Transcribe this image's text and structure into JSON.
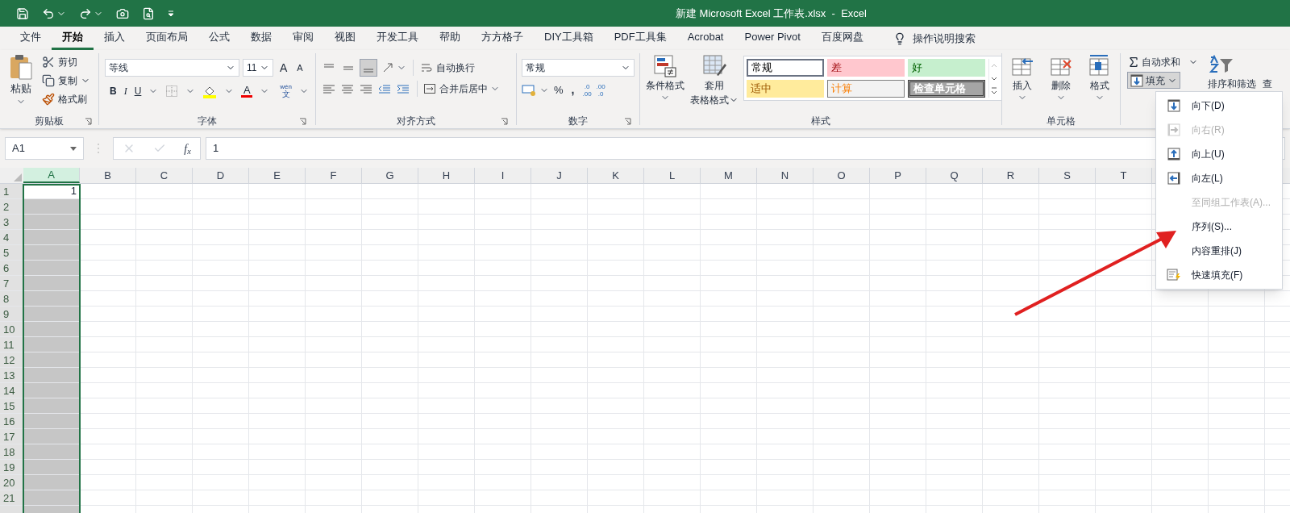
{
  "window": {
    "title": "新建 Microsoft Excel 工作表.xlsx  -  Excel"
  },
  "tabs": [
    {
      "label": "文件",
      "selected": false
    },
    {
      "label": "开始",
      "selected": true
    },
    {
      "label": "插入",
      "selected": false
    },
    {
      "label": "页面布局",
      "selected": false
    },
    {
      "label": "公式",
      "selected": false
    },
    {
      "label": "数据",
      "selected": false
    },
    {
      "label": "审阅",
      "selected": false
    },
    {
      "label": "视图",
      "selected": false
    },
    {
      "label": "开发工具",
      "selected": false
    },
    {
      "label": "帮助",
      "selected": false
    },
    {
      "label": "方方格子",
      "selected": false
    },
    {
      "label": "DIY工具箱",
      "selected": false
    },
    {
      "label": "PDF工具集",
      "selected": false
    },
    {
      "label": "Acrobat",
      "selected": false
    },
    {
      "label": "Power Pivot",
      "selected": false
    },
    {
      "label": "百度网盘",
      "selected": false
    }
  ],
  "tell_me": "操作说明搜索",
  "clipboard": {
    "paste": "粘贴",
    "cut": "剪切",
    "copy": "复制",
    "format_painter": "格式刷",
    "label": "剪贴板"
  },
  "font": {
    "name": "等线",
    "size": "11",
    "grow": "A",
    "shrink": "A",
    "bold": "B",
    "italic": "I",
    "underline": "U",
    "font_color": "A",
    "phonetic": [
      "wén",
      "文"
    ],
    "label": "字体"
  },
  "alignment": {
    "wrap": "自动换行",
    "merge": "合并后居中",
    "label": "对齐方式"
  },
  "number": {
    "format": "常规",
    "percent": "%",
    "comma": ",",
    "increase_decimal": [
      ".0",
      ".00"
    ],
    "decrease_decimal": [
      ".00",
      ".0"
    ],
    "label": "数字"
  },
  "styles": {
    "conditional": "条件格式",
    "table": [
      "套用",
      "表格格式"
    ],
    "label": "样式",
    "cells": [
      {
        "label": "常规",
        "kind": "normal"
      },
      {
        "label": "差",
        "kind": "bad"
      },
      {
        "label": "好",
        "kind": "good"
      },
      {
        "label": "适中",
        "kind": "neutral"
      },
      {
        "label": "计算",
        "kind": "calc"
      },
      {
        "label": "检查单元格",
        "kind": "check"
      }
    ]
  },
  "cells_group": {
    "insert": "插入",
    "delete": "删除",
    "format": "格式",
    "label": "单元格"
  },
  "editing": {
    "autosum": "自动求和",
    "fill": "填充",
    "sort": "排序和筛选",
    "find": "查"
  },
  "formula_bar": {
    "name_box": "A1",
    "fx": "f$_{x}$",
    "value": "1"
  },
  "columns": [
    {
      "label": "A",
      "selected": true
    },
    {
      "label": "B",
      "selected": false
    },
    {
      "label": "C",
      "selected": false
    },
    {
      "label": "D",
      "selected": false
    },
    {
      "label": "E",
      "selected": false
    },
    {
      "label": "F",
      "selected": false
    },
    {
      "label": "G",
      "selected": false
    },
    {
      "label": "H",
      "selected": false
    },
    {
      "label": "I",
      "selected": false
    },
    {
      "label": "J",
      "selected": false
    },
    {
      "label": "K",
      "selected": false
    },
    {
      "label": "L",
      "selected": false
    },
    {
      "label": "M",
      "selected": false
    },
    {
      "label": "N",
      "selected": false
    },
    {
      "label": "O",
      "selected": false
    },
    {
      "label": "P",
      "selected": false
    },
    {
      "label": "Q",
      "selected": false
    },
    {
      "label": "R",
      "selected": false
    },
    {
      "label": "S",
      "selected": false
    },
    {
      "label": "T",
      "selected": false
    }
  ],
  "rows": [
    "1",
    "2",
    "3",
    "4",
    "5",
    "6",
    "7",
    "8",
    "9",
    "10",
    "11",
    "12",
    "13",
    "14",
    "15",
    "16",
    "17",
    "18",
    "19",
    "20",
    "21"
  ],
  "active_cell": {
    "value": "1"
  },
  "fill_menu": {
    "items": [
      {
        "label": "向下(D)",
        "kind": "down",
        "disabled": false
      },
      {
        "label": "向右(R)",
        "kind": "right",
        "disabled": true
      },
      {
        "label": "向上(U)",
        "kind": "up",
        "disabled": false
      },
      {
        "label": "向左(L)",
        "kind": "left",
        "disabled": false
      },
      {
        "label": "至同组工作表(A)...",
        "kind": "plain",
        "disabled": true
      },
      {
        "label": "序列(S)...",
        "kind": "plain",
        "disabled": false
      },
      {
        "label": "内容重排(J)",
        "kind": "plain",
        "disabled": false
      },
      {
        "label": "快速填充(F)",
        "kind": "flash",
        "disabled": false
      }
    ]
  }
}
